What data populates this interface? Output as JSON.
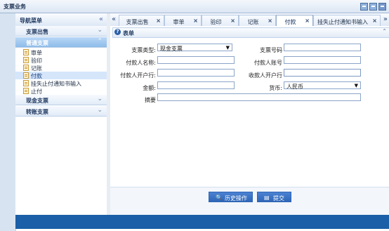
{
  "window": {
    "title": "支票业务"
  },
  "sidebar": {
    "title": "导航菜单",
    "groups": [
      {
        "label": "支票出售"
      },
      {
        "label": "普通支票"
      },
      {
        "label": "现金支票"
      },
      {
        "label": "转账支票"
      }
    ],
    "items": [
      {
        "label": "审单"
      },
      {
        "label": "验印"
      },
      {
        "label": "记账"
      },
      {
        "label": "付款"
      },
      {
        "label": "挂失止付通知书输入"
      },
      {
        "label": "止付"
      }
    ]
  },
  "tabs": [
    {
      "label": "支票出售",
      "active": false
    },
    {
      "label": "审单",
      "active": false
    },
    {
      "label": "验印",
      "active": false
    },
    {
      "label": "记账",
      "active": false
    },
    {
      "label": "付款",
      "active": true
    },
    {
      "label": "挂失止付通知书输入",
      "active": false
    }
  ],
  "form": {
    "title": "表单",
    "fields": {
      "check_type": {
        "label": "支票类型:",
        "value": "现金支票"
      },
      "check_no": {
        "label": "支票号码",
        "value": ""
      },
      "payer_name": {
        "label": "付款人名称:",
        "value": ""
      },
      "payer_account": {
        "label": "付款人账号",
        "value": ""
      },
      "payer_bank": {
        "label": "付款人开户行:",
        "value": ""
      },
      "payee_bank": {
        "label": "收款人开户行",
        "value": ""
      },
      "amount": {
        "label": "金额:",
        "value": ""
      },
      "currency": {
        "label": "货币:",
        "value": "人民币"
      },
      "memo": {
        "label": "摘要",
        "value": ""
      }
    }
  },
  "buttons": {
    "history": "历史操作",
    "submit": "提交"
  },
  "colors": {
    "accent": "#2f66b8",
    "status_bar": "#1a5fa7",
    "sidebar_active": "#8dbce9"
  },
  "icons": {
    "help": "?",
    "history": "🔍",
    "submit": "▤"
  }
}
